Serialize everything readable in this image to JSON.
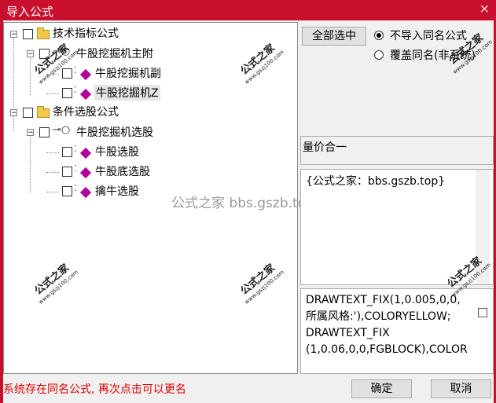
{
  "window": {
    "title": "导入公式"
  },
  "tree": {
    "items": [
      {
        "label": "技术指标公式"
      },
      {
        "label": "牛股挖掘机主附"
      },
      {
        "label": "牛股挖掘机副"
      },
      {
        "label": "牛股挖掘机Z"
      },
      {
        "label": "条件选股公式"
      },
      {
        "label": "牛股挖掘机选股"
      },
      {
        "label": "牛股选股"
      },
      {
        "label": "牛股底选股"
      },
      {
        "label": "擒牛选股"
      }
    ]
  },
  "options": {
    "select_all": "全部选中",
    "no_import": "不导入同名公式",
    "overwrite": "覆盖同名(非系统)"
  },
  "formula_name": "量价合一",
  "description": "{公式之家：bbs.gszb.top}",
  "code_lines": [
    "DRAWTEXT_FIX(1,0.005,0,0,",
    "所属风格:'),COLORYELLOW;",
    "DRAWTEXT_FIX",
    "(1,0.06,0,0,FGBLOCK),COLOR"
  ],
  "watermark": {
    "title": "公式之家",
    "url": "www.gszj100.com",
    "site": "公式之家 bbs.gszb.top"
  },
  "status": "系统存在同名公式, 再次点击可以更名",
  "buttons": {
    "ok": "确定",
    "cancel": "取消"
  }
}
